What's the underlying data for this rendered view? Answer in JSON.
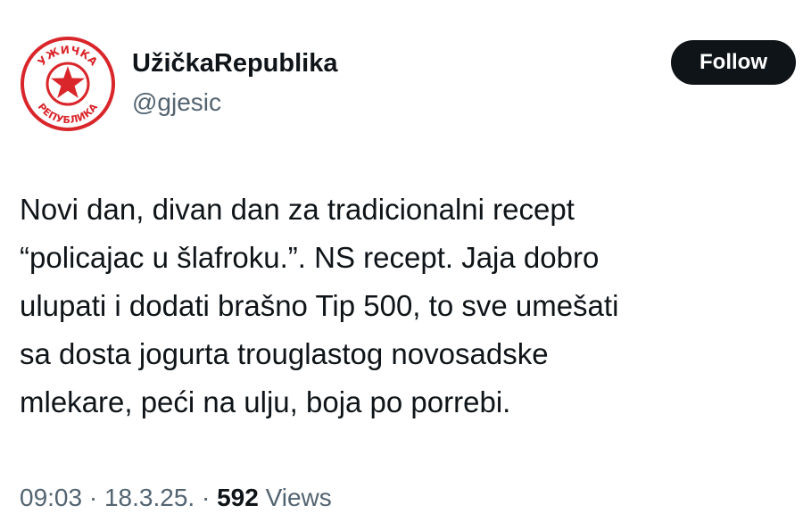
{
  "author": {
    "display_name": "UžičkaRepublika",
    "handle": "@gjesic",
    "avatar": {
      "icon": "red-star-seal-icon",
      "seal_text_top": "УЖИЧКА",
      "seal_text_bottom": "РЕПУБЛИКА",
      "color": "#d9262b"
    }
  },
  "follow_label": "Follow",
  "tweet": {
    "lines": [
      "Novi dan, divan dan za tradicionalni recept",
      "“policajac u šlafroku.”. NS recept. Jaja dobro",
      "ulupati i dodati brašno Tip 500, to sve umešati",
      "sa dosta jogurta trouglastog novosadske",
      "mlekare, peći na ulju, boja po porrebi."
    ]
  },
  "meta": {
    "time": "09:03",
    "separator": "·",
    "date": "18.3.25.",
    "views_count": "592",
    "views_label": "Views"
  }
}
